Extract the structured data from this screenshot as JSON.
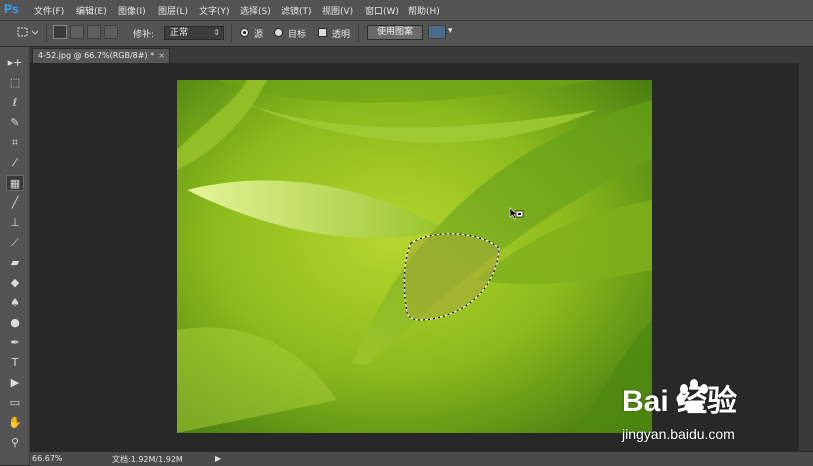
{
  "app": {
    "logo": "Ps"
  },
  "menus": [
    "文件(F)",
    "编辑(E)",
    "图像(I)",
    "图层(L)",
    "文字(Y)",
    "选择(S)",
    "滤镜(T)",
    "视图(V)",
    "窗口(W)",
    "帮助(H)"
  ],
  "options": {
    "patch_label": "修补:",
    "patch_value": "正常",
    "source_label": "源",
    "dest_label": "目标",
    "transparent_label": "透明",
    "use_pattern_label": "使用图案"
  },
  "document": {
    "tab_title": "4-52.jpg @ 66.7%(RGB/8#) *",
    "close_glyph": "×"
  },
  "tools": [
    {
      "name": "move-tool-icon",
      "glyph": "▸+"
    },
    {
      "name": "marquee-tool-icon",
      "glyph": "⬚"
    },
    {
      "name": "lasso-tool-icon",
      "glyph": "ℓ"
    },
    {
      "name": "quick-select-tool-icon",
      "glyph": "✎"
    },
    {
      "name": "crop-tool-icon",
      "glyph": "⌗"
    },
    {
      "name": "eyedropper-tool-icon",
      "glyph": "⁄"
    },
    {
      "name": "patch-tool-icon",
      "glyph": "▦"
    },
    {
      "name": "brush-tool-icon",
      "glyph": "╱"
    },
    {
      "name": "clone-stamp-tool-icon",
      "glyph": "⊥"
    },
    {
      "name": "history-brush-tool-icon",
      "glyph": "⟋"
    },
    {
      "name": "eraser-tool-icon",
      "glyph": "▰"
    },
    {
      "name": "paint-bucket-tool-icon",
      "glyph": "◆"
    },
    {
      "name": "blur-tool-icon",
      "glyph": "♠"
    },
    {
      "name": "dodge-tool-icon",
      "glyph": "●"
    },
    {
      "name": "pen-tool-icon",
      "glyph": "✒"
    },
    {
      "name": "type-tool-icon",
      "glyph": "T"
    },
    {
      "name": "path-select-tool-icon",
      "glyph": "▶"
    },
    {
      "name": "shape-tool-icon",
      "glyph": "▭"
    },
    {
      "name": "hand-tool-icon",
      "glyph": "✋"
    },
    {
      "name": "zoom-tool-icon",
      "glyph": "⚲"
    }
  ],
  "status": {
    "zoom": "66.67%",
    "doc_info": "文档:1.92M/1.92M",
    "arrow": "▶"
  },
  "watermark": {
    "brand": "Bai  经验",
    "sub": "jingyan.baidu.com"
  },
  "colors": {
    "ps_blue": "#31a8ff",
    "panel": "#535353",
    "workspace": "#282828"
  }
}
